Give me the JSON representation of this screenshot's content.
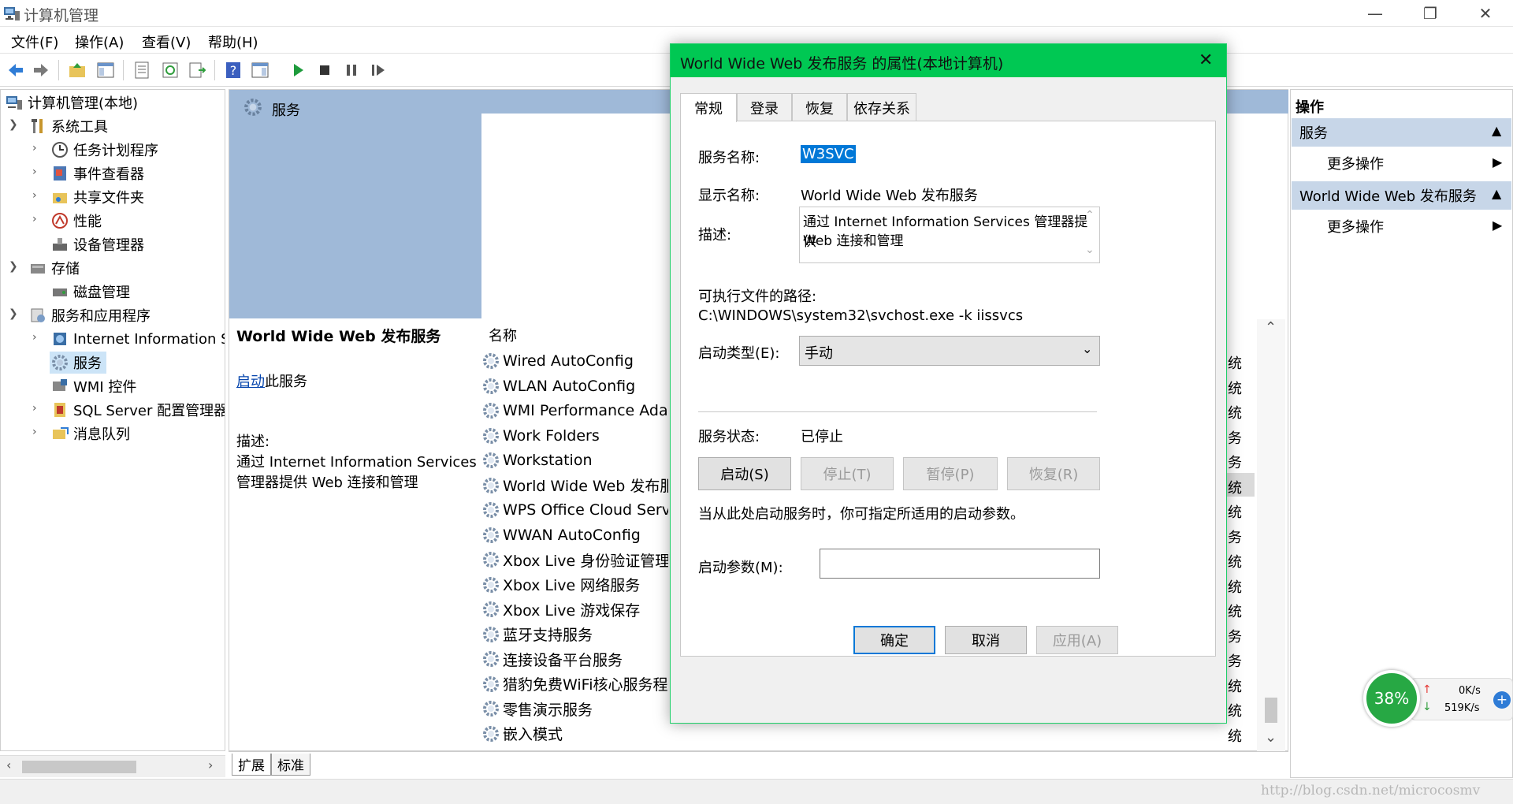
{
  "window": {
    "title": "计算机管理",
    "min": "—",
    "max": "❐",
    "close": "✕"
  },
  "menu": [
    "文件(F)",
    "操作(A)",
    "查看(V)",
    "帮助(H)"
  ],
  "tree": {
    "root": "计算机管理(本地)",
    "items": [
      {
        "label": "系统工具"
      },
      {
        "label": "任务计划程序"
      },
      {
        "label": "事件查看器"
      },
      {
        "label": "共享文件夹"
      },
      {
        "label": "性能"
      },
      {
        "label": "设备管理器"
      },
      {
        "label": "存储"
      },
      {
        "label": "磁盘管理"
      },
      {
        "label": "服务和应用程序"
      },
      {
        "label": "Internet Information S"
      },
      {
        "label": "服务"
      },
      {
        "label": "WMI 控件"
      },
      {
        "label": "SQL Server 配置管理器"
      },
      {
        "label": "消息队列"
      }
    ]
  },
  "center": {
    "header": "服务",
    "selected_name": "World Wide Web 发布服务",
    "start_link": "启动",
    "start_suffix": "此服务",
    "desc_label": "描述:",
    "desc_line1": "通过 Internet Information Services",
    "desc_line2": "管理器提供 Web 连接和管理",
    "col_name": "名称",
    "services": [
      "Wired AutoConfig",
      "WLAN AutoConfig",
      "WMI Performance Adap",
      "Work Folders",
      "Workstation",
      "World Wide Web 发布服",
      "WPS Office Cloud Servic",
      "WWAN AutoConfig",
      "Xbox Live 身份验证管理器",
      "Xbox Live 网络服务",
      "Xbox Live 游戏保存",
      "蓝牙支持服务",
      "连接设备平台服务",
      "猎豹免费WiFi核心服务程序",
      "零售演示服务",
      "嵌入模式"
    ],
    "types": [
      "统",
      "统",
      "统",
      "务",
      "务",
      "统",
      "统",
      "务",
      "统",
      "统",
      "统",
      "务",
      "务",
      "统",
      "统",
      "统"
    ],
    "tab_ext": "扩展",
    "tab_std": "标准"
  },
  "actions": {
    "title": "操作",
    "sec1": "服务",
    "more1": "更多操作",
    "sec2": "World Wide Web 发布服务",
    "more2": "更多操作"
  },
  "dialog": {
    "title": "World Wide Web 发布服务 的属性(本地计算机)",
    "tabs": [
      "常规",
      "登录",
      "恢复",
      "依存关系"
    ],
    "svc_name_label": "服务名称:",
    "svc_name": "W3SVC",
    "disp_label": "显示名称:",
    "disp_name": "World Wide Web 发布服务",
    "desc_label": "描述:",
    "desc1": "通过 Internet Information Services 管理器提供",
    "desc2": "Web 连接和管理",
    "path_label": "可执行文件的路径:",
    "path": "C:\\WINDOWS\\system32\\svchost.exe -k iissvcs",
    "start_type_label": "启动类型(E):",
    "start_type": "手动",
    "status_label": "服务状态:",
    "status": "已停止",
    "btn_start": "启动(S)",
    "btn_stop": "停止(T)",
    "btn_pause": "暂停(P)",
    "btn_resume": "恢复(R)",
    "hint": "当从此处启动服务时，你可指定所适用的启动参数。",
    "param_label": "启动参数(M):",
    "ok": "确定",
    "cancel": "取消",
    "apply": "应用(A)"
  },
  "widget": {
    "percent": "38%",
    "up": "0K/s",
    "down": "519K/s"
  },
  "watermark": "http://blog.csdn.net/microcosmv"
}
